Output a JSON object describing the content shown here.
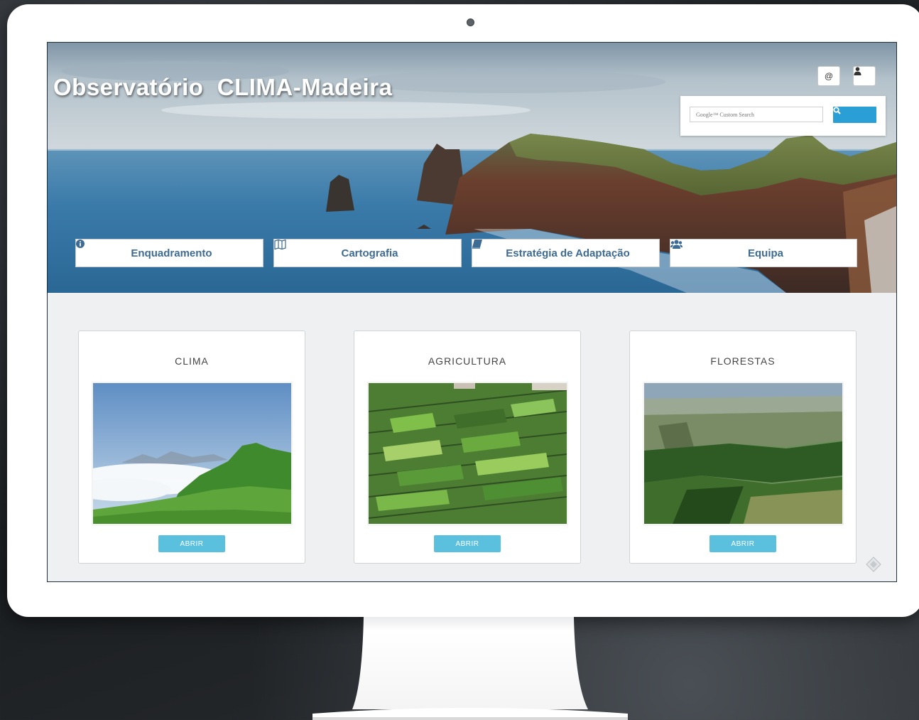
{
  "header": {
    "site_title": "Observatório  CLIMA-Madeira",
    "contact_icon_glyph": "@",
    "user_icon": "user-icon"
  },
  "search": {
    "placeholder": "Google™ Custom Search",
    "button_icon": "search-icon"
  },
  "nav": {
    "items": [
      {
        "label": "Enquadramento",
        "icon": "info-circle-icon"
      },
      {
        "label": "Cartografia",
        "icon": "map-icon"
      },
      {
        "label": "Estratégia de Adaptação",
        "icon": "book-icon"
      },
      {
        "label": "Equipa",
        "icon": "users-icon"
      }
    ]
  },
  "cards": [
    {
      "title": "CLIMA",
      "button": "ABRIR",
      "image": "green-hill-above-clouds"
    },
    {
      "title": "AGRICULTURA",
      "button": "ABRIR",
      "image": "terraced-farm-fields"
    },
    {
      "title": "FLORESTAS",
      "button": "ABRIR",
      "image": "forest-valley"
    }
  ],
  "colors": {
    "accent": "#2a9fd6",
    "button_info": "#5bc0de",
    "nav_text": "#3d6b93"
  }
}
